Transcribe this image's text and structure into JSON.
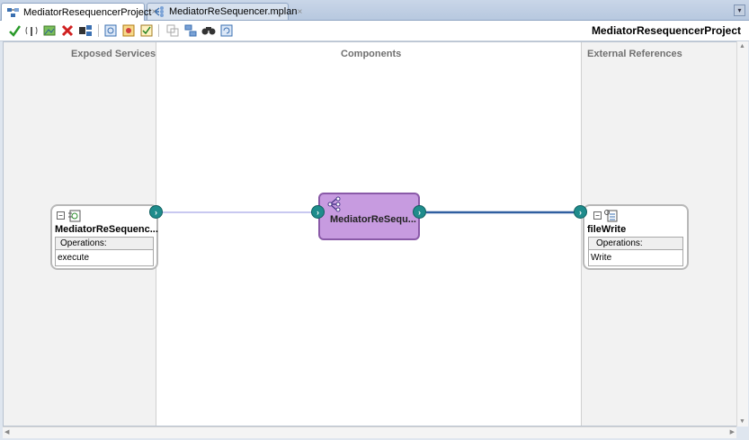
{
  "tabs": [
    {
      "label": "MediatorResequencerProject",
      "close": "×"
    },
    {
      "label": "MediatorReSequencer.mplan",
      "close": "×"
    }
  ],
  "toolbar": {
    "project_title": "MediatorResequencerProject",
    "icons": [
      "validate-icon",
      "antenna-icon",
      "image-icon",
      "delete-icon",
      "deploy-icon",
      "test-icon",
      "security-icon",
      "checklist-icon",
      "create-icon",
      "layout-icon",
      "find-icon",
      "refresh-icon"
    ]
  },
  "lanes": {
    "exposed": "Exposed Services",
    "components": "Components",
    "external": "External References"
  },
  "service": {
    "name": "MediatorReSequenc...",
    "ops_label": "Operations:",
    "operation": "execute"
  },
  "mediator": {
    "name": "MediatorReSequ..."
  },
  "reference": {
    "name": "fileWrite",
    "ops_label": "Operations:",
    "operation": "Write"
  },
  "colors": {
    "mediator_fill": "#c79be0",
    "wire_in": "#c8c8f0",
    "wire_out": "#2f5fa0",
    "port": "#1f8c8c"
  }
}
